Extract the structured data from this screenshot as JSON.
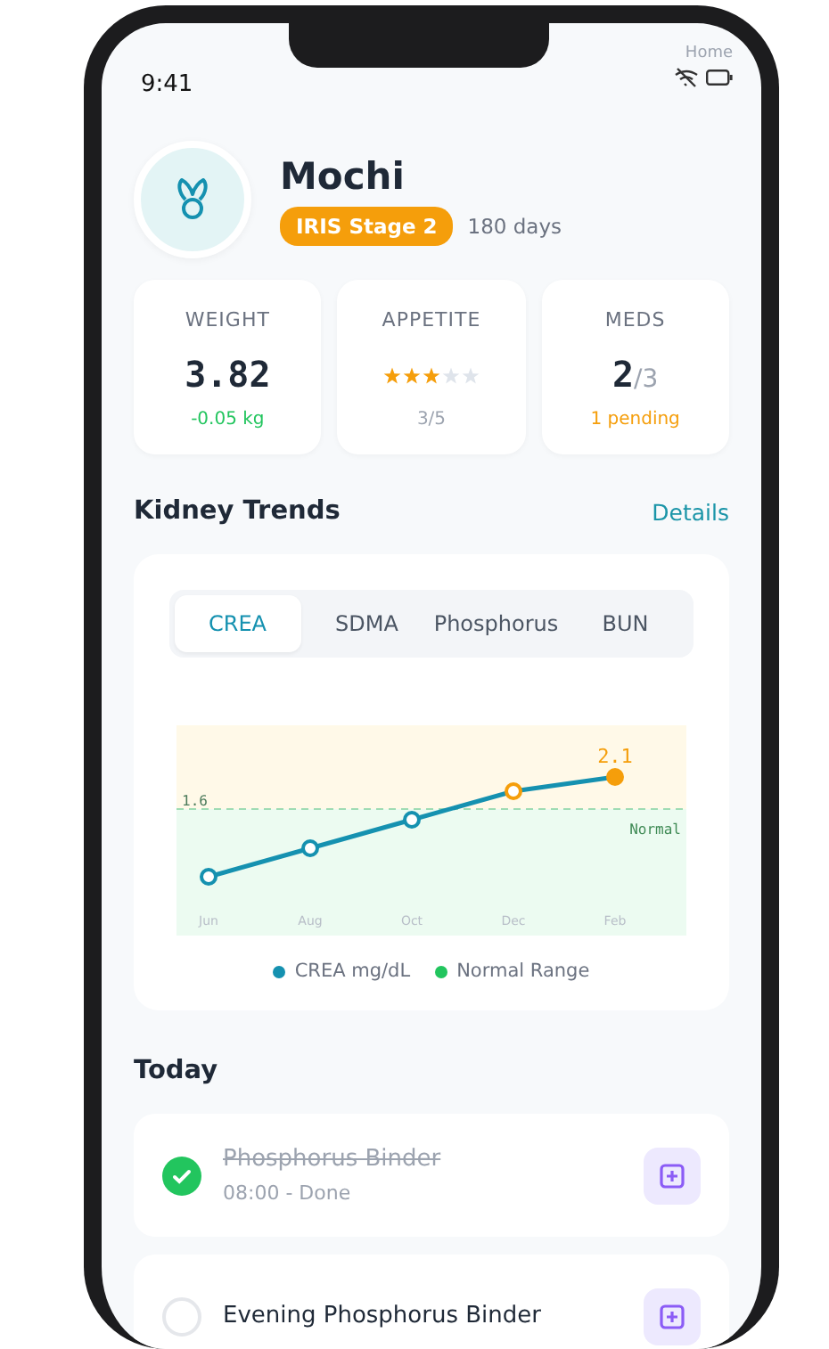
{
  "status_bar": {
    "time": "9:41",
    "label": "Home"
  },
  "pet": {
    "name": "Mochi",
    "stage": "IRIS Stage 2",
    "duration": "180 days"
  },
  "stats": [
    {
      "kind": "value",
      "label": "WEIGHT",
      "value": "3.82",
      "note": "-0.05 kg",
      "color": "#22c55e"
    },
    {
      "kind": "rating",
      "label": "APPETITE",
      "stars": 3,
      "note": "3/5",
      "color": "#9ca3af"
    },
    {
      "kind": "fraction",
      "label": "MEDS",
      "value": "2",
      "total": "/3",
      "note": "1 pending",
      "color": "#f59e0b"
    }
  ],
  "trends": {
    "title": "Kidney Trends",
    "link": "Details",
    "tabs": [
      {
        "label": "CREA",
        "selected": true
      },
      {
        "label": "SDMA",
        "selected": false
      },
      {
        "label": "Phosphorus",
        "selected": false
      },
      {
        "label": "BUN",
        "selected": false
      }
    ],
    "chart": {
      "threshold_label": "1.6",
      "zone_label": "Normal",
      "value_label": "2.1",
      "x_labels": [
        "Jun",
        "Aug",
        "Oct",
        "Dec",
        "Feb"
      ]
    },
    "legend": [
      {
        "label": "CREA mg/dL",
        "color": "#1591b0"
      },
      {
        "label": "Normal Range",
        "color": "#22c55e"
      }
    ]
  },
  "today": {
    "title": "Today",
    "tasks": [
      {
        "title": "Phosphorus Binder",
        "time": "08:00 - Done",
        "done": true
      },
      {
        "title": "Evening Phosphorus Binder",
        "done": false
      }
    ]
  }
}
